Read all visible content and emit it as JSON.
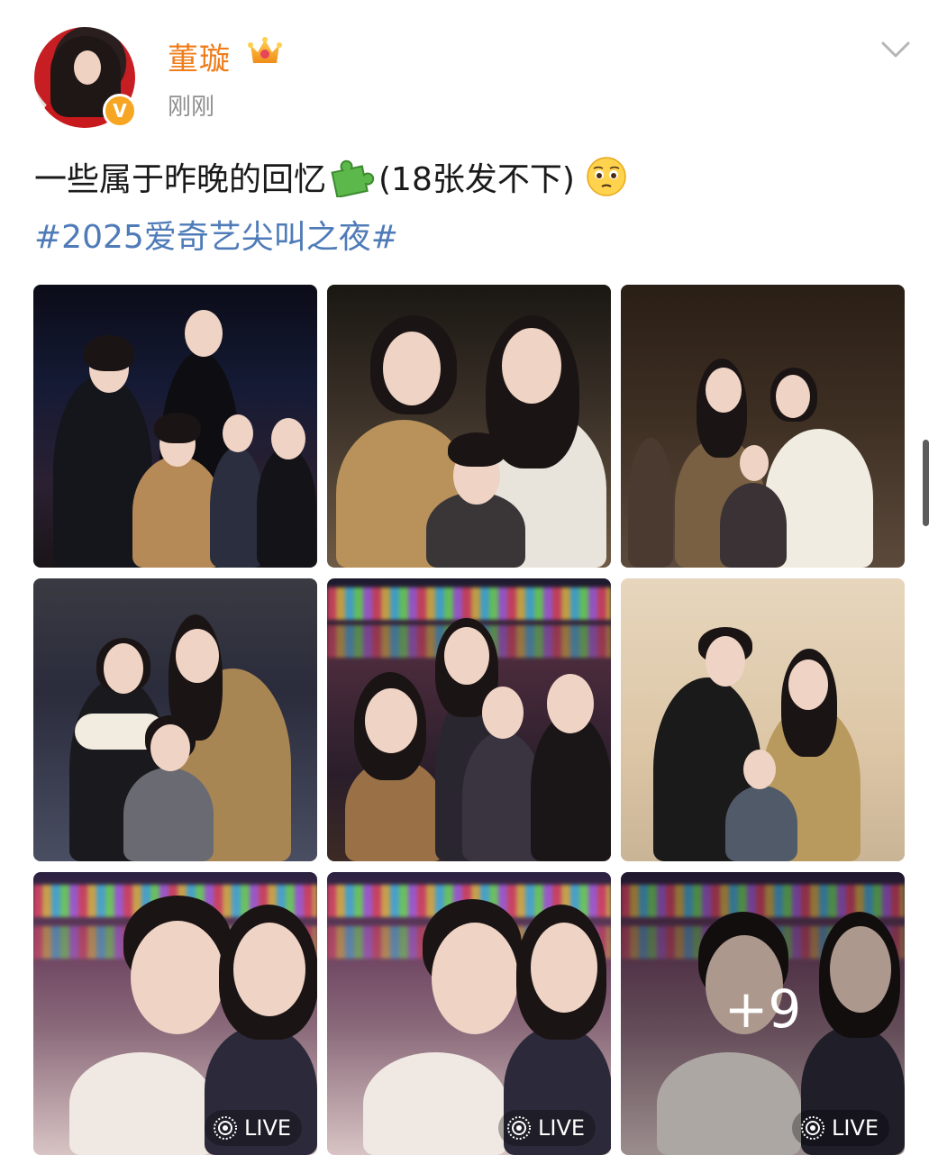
{
  "post": {
    "username": "董璇",
    "timestamp": "刚刚",
    "verified_icon": "v-badge-icon",
    "vip_icon": "crown-icon",
    "text_part1": "一些属于昨晚的回忆",
    "text_part2": "(18张发不下)",
    "hashtag": "#2025爱奇艺尖叫之夜#",
    "more_count_label": "+9",
    "live_label": "LIVE"
  },
  "colors": {
    "username": "#f07c1a",
    "hashtag": "#4f7bb8",
    "timestamp": "#8f8f8f"
  },
  "photos": {
    "total_shown": 9,
    "live_photos": [
      7,
      8,
      9
    ]
  }
}
